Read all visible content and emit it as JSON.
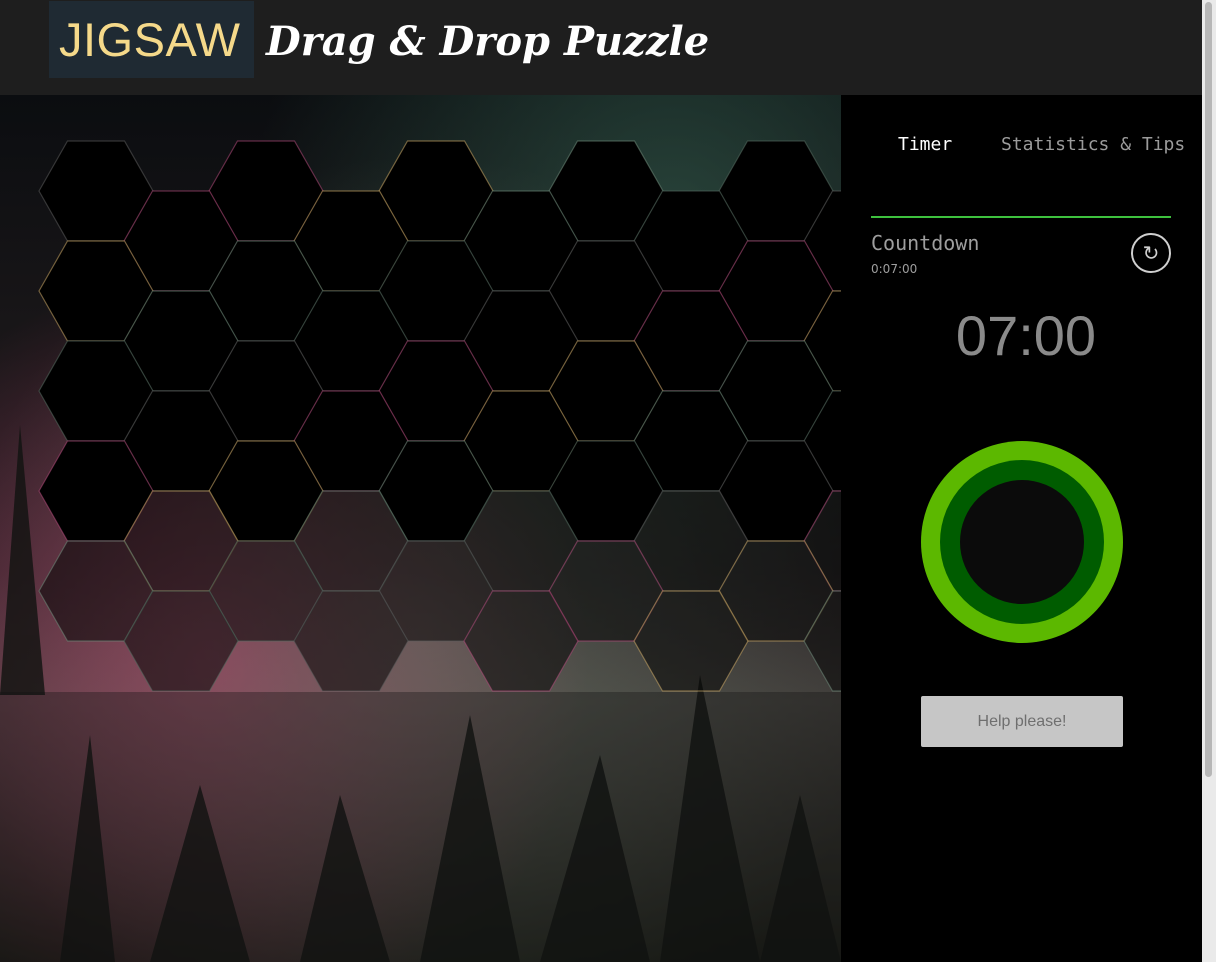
{
  "header": {
    "logo": "JIGSAW",
    "subtitle": "Drag & Drop Puzzle"
  },
  "sidebar": {
    "tabs": [
      "Timer",
      "Statistics & Tips"
    ],
    "active_tab": "Timer",
    "countdown": {
      "title": "Countdown",
      "setting": "0:07:00",
      "display": "07:00",
      "progress": 1.0
    },
    "help_button": "Help please!"
  },
  "puzzle": {
    "piece_shape": "hexagon",
    "slot_rows": 10,
    "slot_columns": 5,
    "filled_slots": 0
  },
  "colors": {
    "accent_green": "#3ec13e",
    "ring_outer": "#5cb800",
    "ring_inner": "#005c00",
    "logo_color": "#f5d98a"
  },
  "icons": {
    "reset": "refresh-icon"
  }
}
